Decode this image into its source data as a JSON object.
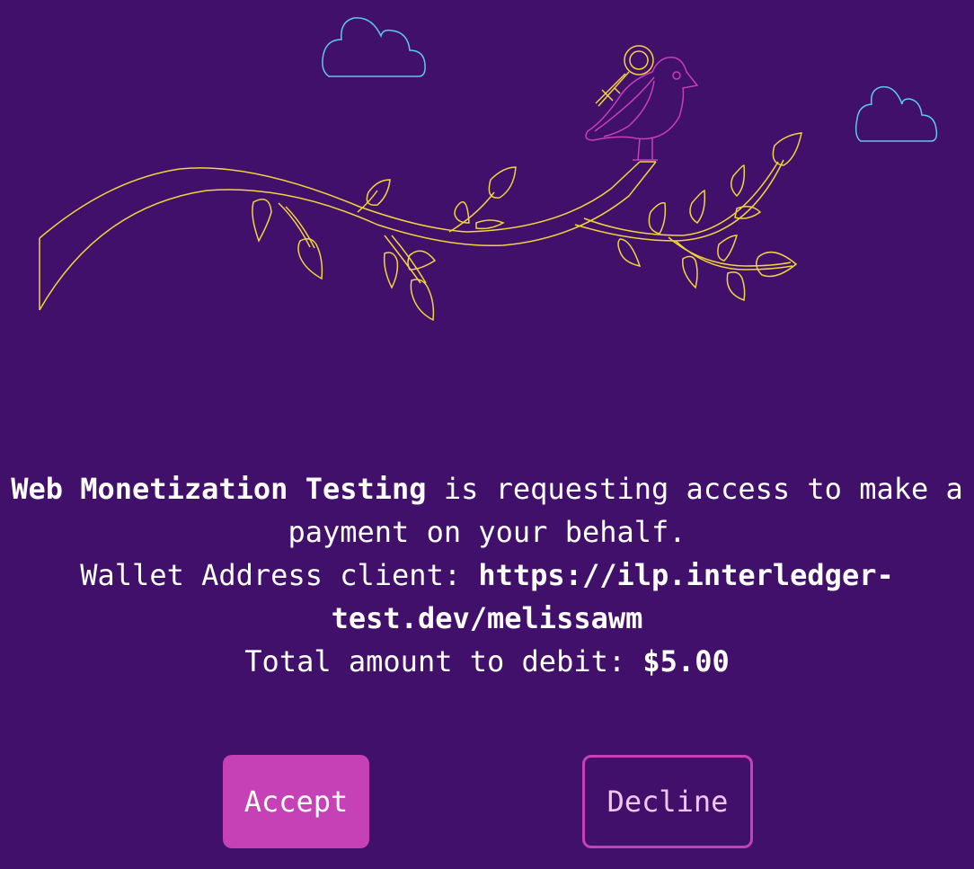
{
  "consent": {
    "app_name": "Web Monetization Testing",
    "request_text": " is requesting access to make a payment on your behalf.",
    "wallet_label": "Wallet Address client: ",
    "wallet_address_line1": "https://ilp.interledger-",
    "wallet_address_line2": "test.dev/melissawm",
    "amount_label": "Total amount to debit: ",
    "amount_value": "$5.00"
  },
  "actions": {
    "accept_label": "Accept",
    "decline_label": "Decline"
  },
  "illustration": {
    "icons": [
      "cloud-icon",
      "cloud-icon",
      "bird-icon",
      "key-icon",
      "branch-icon"
    ],
    "colors": {
      "background": "#41106a",
      "branch": "#f2d43c",
      "bird": "#c640b6",
      "cloud": "#5ec8f0",
      "accept": "#c640b6"
    }
  }
}
